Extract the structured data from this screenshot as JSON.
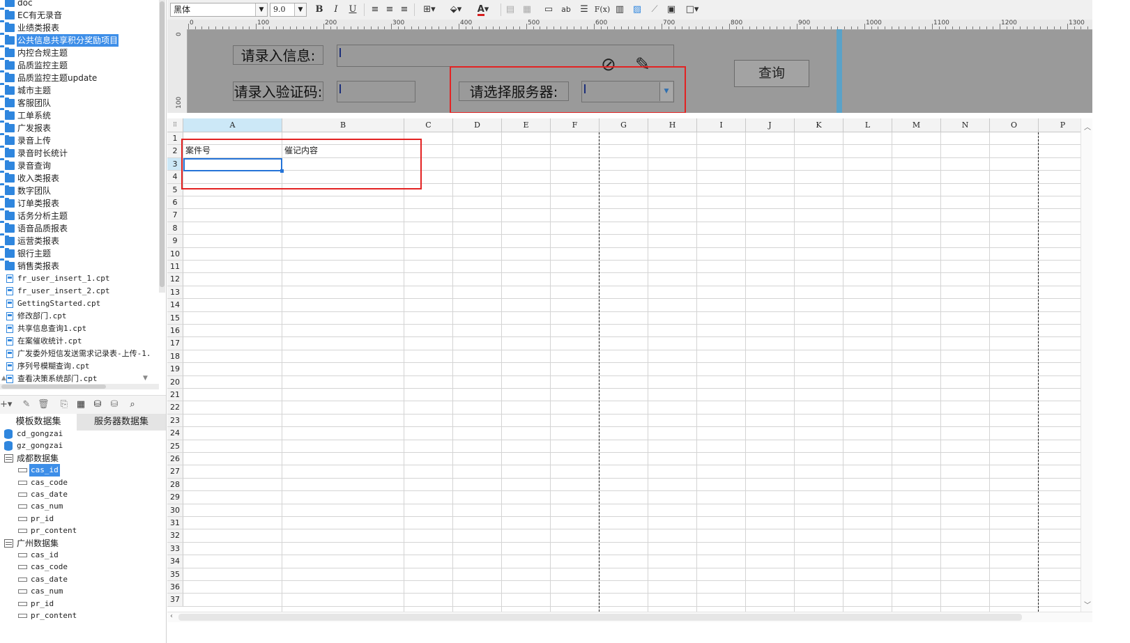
{
  "tree": {
    "items": [
      {
        "label": "doc",
        "type": "folder"
      },
      {
        "label": "EC有无录音",
        "type": "folder"
      },
      {
        "label": "业绩类报表",
        "type": "folder"
      },
      {
        "label": "公共信息共享积分奖励项目",
        "type": "folder",
        "selected": true
      },
      {
        "label": "内控合规主题",
        "type": "folder"
      },
      {
        "label": "品质监控主题",
        "type": "folder"
      },
      {
        "label": "品质监控主题update",
        "type": "folder"
      },
      {
        "label": "城市主题",
        "type": "folder"
      },
      {
        "label": "客服团队",
        "type": "folder"
      },
      {
        "label": "工单系统",
        "type": "folder"
      },
      {
        "label": "广发报表",
        "type": "folder"
      },
      {
        "label": "录音上传",
        "type": "folder"
      },
      {
        "label": "录音时长统计",
        "type": "folder"
      },
      {
        "label": "录音查询",
        "type": "folder"
      },
      {
        "label": "收入类报表",
        "type": "folder"
      },
      {
        "label": "数字团队",
        "type": "folder"
      },
      {
        "label": "订单类报表",
        "type": "folder"
      },
      {
        "label": "话务分析主题",
        "type": "folder"
      },
      {
        "label": "语音品质报表",
        "type": "folder"
      },
      {
        "label": "运营类报表",
        "type": "folder"
      },
      {
        "label": "银行主题",
        "type": "folder"
      },
      {
        "label": "销售类报表",
        "type": "folder"
      },
      {
        "label": "fr_user_insert_1.cpt",
        "type": "file"
      },
      {
        "label": "fr_user_insert_2.cpt",
        "type": "file"
      },
      {
        "label": "GettingStarted.cpt",
        "type": "file"
      },
      {
        "label": "修改部门.cpt",
        "type": "file"
      },
      {
        "label": "共享信息查询1.cpt",
        "type": "file"
      },
      {
        "label": "在案催收统计.cpt",
        "type": "file"
      },
      {
        "label": "广发委外短信发送需求记录表-上传-1.",
        "type": "file"
      },
      {
        "label": "序列号模糊查询.cpt",
        "type": "file"
      },
      {
        "label": "查看决策系统部门.cpt",
        "type": "file"
      }
    ]
  },
  "dataset_tabs": {
    "template": "模板数据集",
    "server": "服务器数据集"
  },
  "datasets": [
    {
      "label": "cd_gongzai",
      "kind": "db",
      "indent": 0
    },
    {
      "label": "gz_gongzai",
      "kind": "db",
      "indent": 0
    },
    {
      "label": "成都数据集",
      "kind": "table",
      "indent": 0,
      "cn": true
    },
    {
      "label": "cas_id",
      "kind": "field",
      "indent": 1,
      "selected": true
    },
    {
      "label": "cas_code",
      "kind": "field",
      "indent": 1
    },
    {
      "label": "cas_date",
      "kind": "field",
      "indent": 1
    },
    {
      "label": "cas_num",
      "kind": "field",
      "indent": 1
    },
    {
      "label": "pr_id",
      "kind": "field",
      "indent": 1
    },
    {
      "label": "pr_content",
      "kind": "field",
      "indent": 1
    },
    {
      "label": "广州数据集",
      "kind": "table",
      "indent": 0,
      "cn": true
    },
    {
      "label": "cas_id",
      "kind": "field",
      "indent": 1
    },
    {
      "label": "cas_code",
      "kind": "field",
      "indent": 1
    },
    {
      "label": "cas_date",
      "kind": "field",
      "indent": 1
    },
    {
      "label": "cas_num",
      "kind": "field",
      "indent": 1
    },
    {
      "label": "pr_id",
      "kind": "field",
      "indent": 1
    },
    {
      "label": "pr_content",
      "kind": "field",
      "indent": 1
    }
  ],
  "toolbar": {
    "font_name": "黑体",
    "font_size": "9.0",
    "bold": "B",
    "italic": "I",
    "underline": "U",
    "formula": "F(x)",
    "ab": "ab",
    "text_color": "#d61f1f"
  },
  "ruler": {
    "h_ticks": [
      "0",
      "100",
      "200",
      "300",
      "400",
      "500",
      "600",
      "700",
      "800",
      "900",
      "1000",
      "1100",
      "1200",
      "1300"
    ],
    "v_ticks": [
      "0",
      "100"
    ]
  },
  "form": {
    "info_label": "请录入信息:",
    "code_label": "请录入验证码:",
    "server_label": "请选择服务器:",
    "query_button": "查询"
  },
  "grid": {
    "columns": [
      "A",
      "B",
      "C",
      "D",
      "E",
      "F",
      "G",
      "H",
      "I",
      "J",
      "K",
      "L",
      "M",
      "N",
      "O",
      "P"
    ],
    "rows": [
      "1",
      "2",
      "3",
      "4",
      "5",
      "6",
      "7",
      "8",
      "9",
      "10",
      "11",
      "12",
      "13",
      "14",
      "15",
      "16",
      "17",
      "18",
      "19",
      "20",
      "21",
      "22",
      "23",
      "24",
      "25",
      "26",
      "27",
      "28",
      "29",
      "30",
      "31",
      "32",
      "33",
      "34",
      "35",
      "36",
      "37"
    ],
    "cells": {
      "A2": "案件号",
      "B2": "催记内容"
    }
  },
  "colors": {
    "accent": "#3d8ee8",
    "highlight_box": "#e32222",
    "selection": "#2574d8"
  }
}
